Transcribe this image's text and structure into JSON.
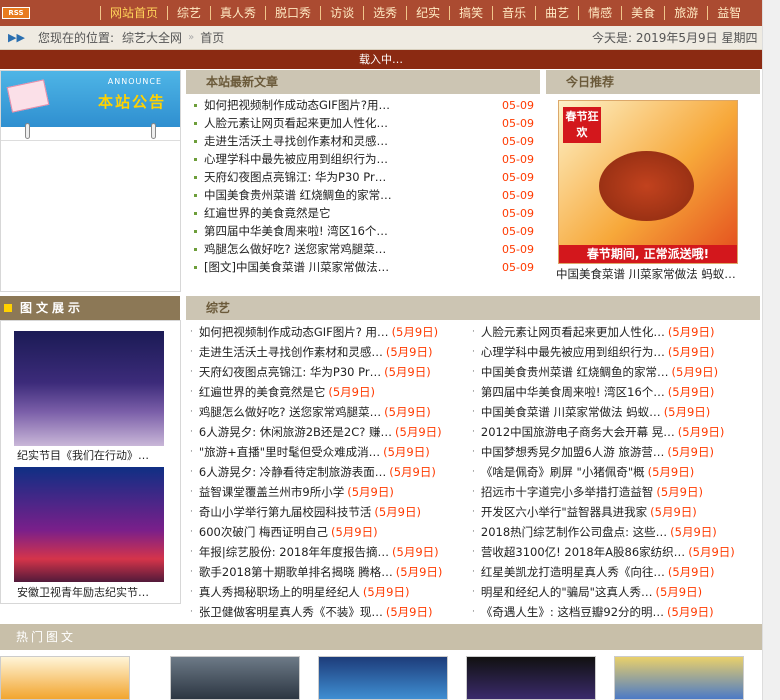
{
  "topnav": {
    "rss_label": "RSS",
    "items": [
      "网站首页",
      "综艺",
      "真人秀",
      "脱口秀",
      "访谈",
      "选秀",
      "纪实",
      "搞笑",
      "音乐",
      "曲艺",
      "情感",
      "美食",
      "旅游",
      "益智"
    ]
  },
  "location": {
    "label": "您现在的位置:",
    "crumb1": "综艺大全网",
    "crumb2": "首页",
    "today": "今天是: 2019年5月9日 星期四"
  },
  "loading_text": "载入中…",
  "announce": {
    "en": "ANNOUNCE",
    "cn": "本站公告"
  },
  "latest": {
    "title": "本站最新文章",
    "items": [
      {
        "t": "如何把视频制作成动态GIF图片?用…",
        "d": "05-09"
      },
      {
        "t": "人脸元素让网页看起来更加人性化…",
        "d": "05-09"
      },
      {
        "t": "走进生活沃土寻找创作素材和灵感…",
        "d": "05-09"
      },
      {
        "t": "心理学科中最先被应用到组织行为…",
        "d": "05-09"
      },
      {
        "t": "天府幻夜图点亮锦江: 华为P30 Pr…",
        "d": "05-09"
      },
      {
        "t": "中国美食贵州菜谱 红烧鲷鱼的家常…",
        "d": "05-09"
      },
      {
        "t": "红遍世界的美食竟然是它",
        "d": "05-09"
      },
      {
        "t": "第四届中华美食周来啦! 湾区16个…",
        "d": "05-09"
      },
      {
        "t": "鸡腿怎么做好吃? 送您家常鸡腿菜…",
        "d": "05-09"
      },
      {
        "t": "[图文]中国美食菜谱 川菜家常做法…",
        "d": "05-09"
      }
    ]
  },
  "recommend": {
    "title": "今日推荐",
    "tag": "春节狂欢",
    "banner": "春节期间, 正常派送哦!",
    "caption": "中国美食菜谱 川菜家常做法 蚂蚁…"
  },
  "pictures": {
    "title": "图文展示",
    "items": [
      {
        "caption": "纪实节目《我们在行动》…"
      },
      {
        "caption": "安徽卫视青年励志纪实节…"
      }
    ]
  },
  "variety": {
    "title": "综艺",
    "left": [
      {
        "t": "如何把视频制作成动态GIF图片? 用…",
        "d": "(5月9日)"
      },
      {
        "t": "走进生活沃土寻找创作素材和灵感…",
        "d": "(5月9日)"
      },
      {
        "t": "天府幻夜图点亮锦江: 华为P30 Pr…",
        "d": "(5月9日)"
      },
      {
        "t": "红遍世界的美食竟然是它",
        "d": "(5月9日)"
      },
      {
        "t": "鸡腿怎么做好吃? 送您家常鸡腿菜…",
        "d": "(5月9日)"
      },
      {
        "t": "6人游晃夕: 休闲旅游2B还是2C? 赚…",
        "d": "(5月9日)"
      },
      {
        "t": "\"旅游+直播\"里时髦但受众难成消…",
        "d": "(5月9日)"
      },
      {
        "t": "6人游晃夕: 冷静看待定制旅游表面…",
        "d": "(5月9日)"
      },
      {
        "t": "益智课堂覆盖兰州市9所小学",
        "d": "(5月9日)"
      },
      {
        "t": "奇山小学举行第九届校园科技节活",
        "d": "(5月9日)"
      },
      {
        "t": "600次破门 梅西证明自己",
        "d": "(5月9日)"
      },
      {
        "t": "年报|综艺股份: 2018年年度报告摘…",
        "d": "(5月9日)"
      },
      {
        "t": "歌手2018第十期歌单排名揭晓 腾格…",
        "d": "(5月9日)"
      },
      {
        "t": "真人秀揭秘职场上的明星经纪人",
        "d": "(5月9日)"
      },
      {
        "t": "张卫健做客明星真人秀《不装》现…",
        "d": "(5月9日)"
      }
    ],
    "right": [
      {
        "t": "人脸元素让网页看起来更加人性化…",
        "d": "(5月9日)"
      },
      {
        "t": "心理学科中最先被应用到组织行为…",
        "d": "(5月9日)"
      },
      {
        "t": "中国美食贵州菜谱 红烧鲷鱼的家常…",
        "d": "(5月9日)"
      },
      {
        "t": "第四届中华美食周来啦! 湾区16个…",
        "d": "(5月9日)"
      },
      {
        "t": "中国美食菜谱 川菜家常做法 蚂蚁…",
        "d": "(5月9日)"
      },
      {
        "t": "2012中国旅游电子商务大会开幕 晃…",
        "d": "(5月9日)"
      },
      {
        "t": "中国梦想秀晃夕加盟6人游 旅游营…",
        "d": "(5月9日)"
      },
      {
        "t": "《啥是佩奇》刷屏 \"小猪佩奇\"概",
        "d": "(5月9日)"
      },
      {
        "t": "招远市十字道完小多举措打造益智",
        "d": "(5月9日)"
      },
      {
        "t": "开发区六小举行\"益智器具进我家",
        "d": "(5月9日)"
      },
      {
        "t": "2018热门综艺制作公司盘点: 这些…",
        "d": "(5月9日)"
      },
      {
        "t": "营收超3100亿! 2018年A股86家纺织…",
        "d": "(5月9日)"
      },
      {
        "t": "红星美凯龙打造明星真人秀《向往…",
        "d": "(5月9日)"
      },
      {
        "t": "明星和经纪人的\"骗局\"这真人秀…",
        "d": "(5月9日)"
      },
      {
        "t": "《奇遇人生》: 这档豆瓣92分的明…",
        "d": "(5月9日)"
      }
    ]
  },
  "hot": {
    "title": "热门图文"
  }
}
